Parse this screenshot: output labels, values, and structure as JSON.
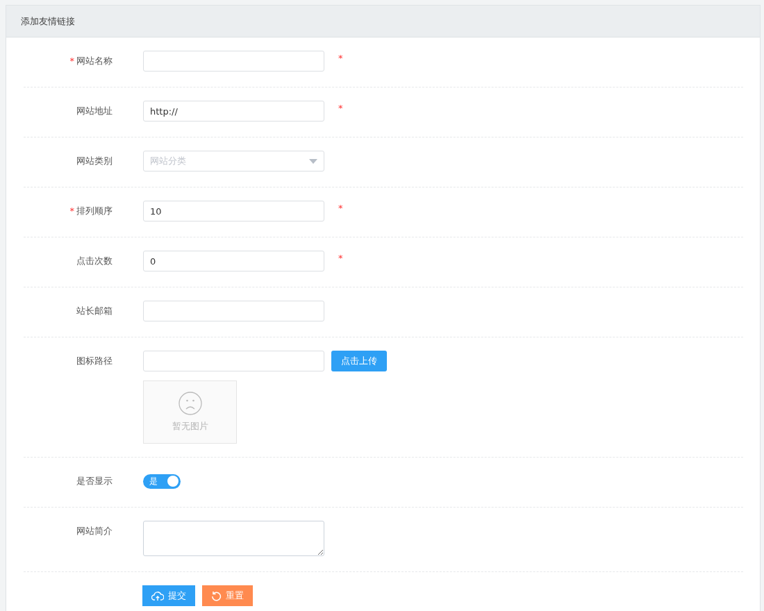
{
  "panel": {
    "title": "添加友情链接"
  },
  "fields": [
    {
      "kind": "text",
      "prefix": "*",
      "label": "网站名称",
      "suffix": "*"
    },
    {
      "kind": "text",
      "label": "网站地址",
      "value": "http://",
      "suffix": "*"
    },
    {
      "kind": "select",
      "label": "网站类别",
      "placeholder": "网站分类"
    },
    {
      "kind": "text",
      "prefix": "*",
      "label": "排列顺序",
      "value": "10",
      "suffix": "*"
    },
    {
      "kind": "text",
      "label": "点击次数",
      "value": "0",
      "suffix": "*"
    },
    {
      "kind": "text",
      "label": "站长邮箱"
    },
    {
      "kind": "upload",
      "label": "图标路径",
      "button": "点击上传",
      "preview_text": "暂无图片"
    },
    {
      "kind": "switch",
      "label": "是否显示",
      "on": true,
      "switch_text": "是"
    },
    {
      "kind": "textarea",
      "label": "网站简介"
    }
  ],
  "actions": [
    {
      "kind": "submit",
      "label": "提交"
    },
    {
      "kind": "reset",
      "label": "重置"
    }
  ]
}
